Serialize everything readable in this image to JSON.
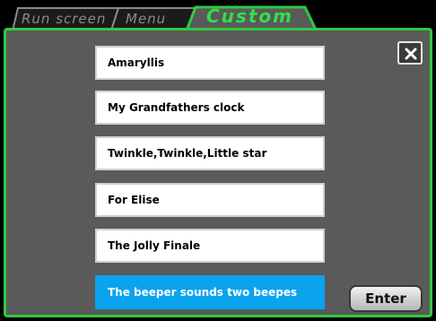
{
  "tabs": [
    {
      "label": "Run screen",
      "active": false
    },
    {
      "label": "Menu",
      "active": false
    },
    {
      "label": "Custom",
      "active": true
    }
  ],
  "songs": [
    {
      "label": "Amaryllis",
      "selected": false
    },
    {
      "label": "My Grandfathers clock",
      "selected": false
    },
    {
      "label": "Twinkle,Twinkle,Little star",
      "selected": false
    },
    {
      "label": "For Elise",
      "selected": false
    },
    {
      "label": "The Jolly Finale",
      "selected": false
    },
    {
      "label": "The beeper sounds two beepes",
      "selected": true
    }
  ],
  "close_icon": "close-icon",
  "enter_label": "Enter",
  "colors": {
    "panel_border": "#2fca3f",
    "active_tab_text": "#2fe04a",
    "selected_item": "#0aa3ee",
    "panel_background": "#5a5a5a"
  }
}
